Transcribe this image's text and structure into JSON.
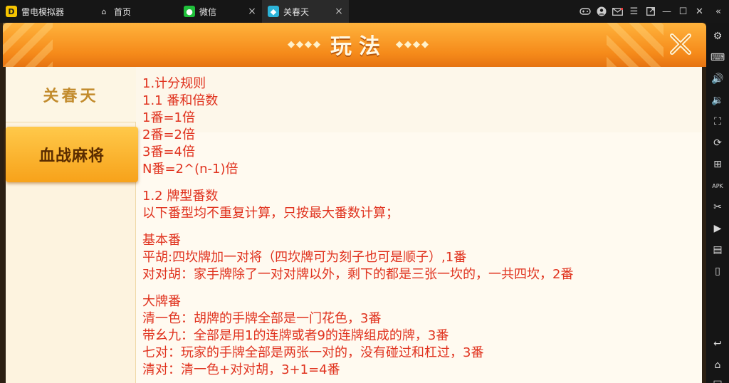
{
  "emulator": {
    "tabs": [
      {
        "label": "雷电模拟器",
        "icon": "app-logo-icon"
      },
      {
        "label": "首页",
        "icon": "home-icon"
      },
      {
        "label": "微信",
        "icon": "wechat-icon"
      },
      {
        "label": "关春天",
        "icon": "game-icon"
      }
    ],
    "close_glyph": "×",
    "toolbar_icons": [
      "gamepad-icon",
      "account-icon",
      "mail-icon",
      "menu-icon",
      "popout-icon",
      "minimize-icon",
      "maximize-icon",
      "close-icon",
      "collapse-icon"
    ],
    "sidebar_icons": [
      "settings-icon",
      "keyboard-icon",
      "volume-up-icon",
      "volume-down-icon",
      "fullscreen-icon",
      "rotate-icon",
      "add-window-icon",
      "apk-icon",
      "cut-icon",
      "video-icon",
      "multi-instance-icon",
      "shake-icon",
      "back-icon",
      "home-icon",
      "recent-apps-icon"
    ],
    "apk_label": "APK"
  },
  "game": {
    "title": "玩法",
    "left_ornament": "◆◆◆◆",
    "right_ornament": "◆◆◆◆",
    "menu": [
      {
        "label": "关春天",
        "active": false
      },
      {
        "label": "血战麻将",
        "active": true
      }
    ],
    "rules": [
      "1.计分规则",
      "1.1 番和倍数",
      "1番=1倍",
      "2番=2倍",
      "3番=4倍",
      "N番=2^(n-1)倍",
      "",
      "1.2 牌型番数",
      "以下番型均不重复计算，只按最大番数计算；",
      "",
      "基本番",
      "平胡:四坎牌加一对将（四坎牌可为刻子也可是顺子）,1番",
      "对对胡：家手牌除了一对对牌以外，剩下的都是三张一坎的，一共四坎，2番",
      "",
      "大牌番",
      "清一色：胡牌的手牌全部是一门花色，3番",
      "带幺九：全部是用1的连牌或者9的连牌组成的牌，3番",
      "七对：玩家的手牌全部是两张一对的，没有碰过和杠过，3番",
      "清对：清一色+对对胡，3+1=4番"
    ]
  }
}
